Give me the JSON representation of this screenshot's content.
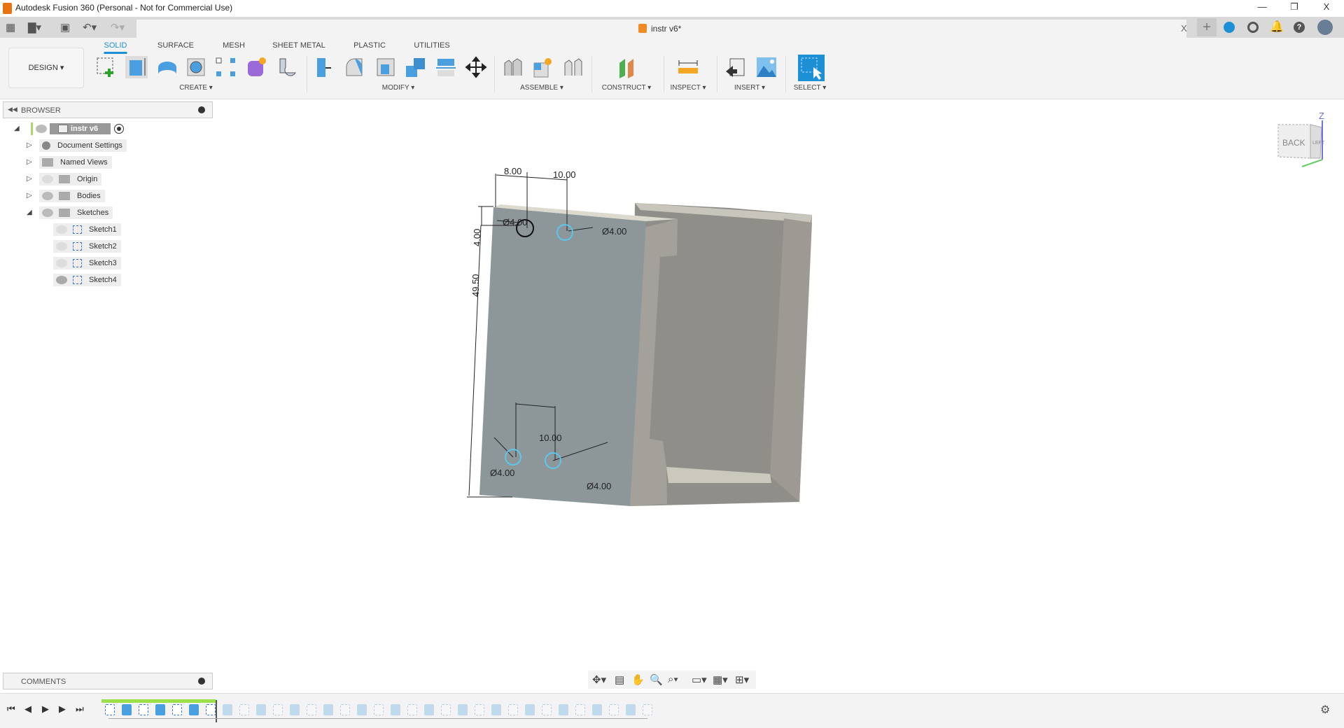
{
  "window": {
    "title": "Autodesk Fusion 360 (Personal - Not for Commercial Use)",
    "min": "—",
    "max": "❐",
    "close": "X"
  },
  "doc_tab": {
    "name": "instr v6*",
    "close": "X"
  },
  "ribbon": {
    "workspace": "DESIGN ▾",
    "tabs": [
      {
        "label": "SOLID",
        "active": true
      },
      {
        "label": "SURFACE"
      },
      {
        "label": "MESH"
      },
      {
        "label": "SHEET METAL"
      },
      {
        "label": "PLASTIC"
      },
      {
        "label": "UTILITIES"
      }
    ],
    "groups": [
      {
        "label": "CREATE ▾"
      },
      {
        "label": "MODIFY ▾"
      },
      {
        "label": "ASSEMBLE ▾"
      },
      {
        "label": "CONSTRUCT ▾"
      },
      {
        "label": "INSPECT ▾"
      },
      {
        "label": "INSERT ▾"
      },
      {
        "label": "SELECT ▾"
      }
    ]
  },
  "browser": {
    "title": "BROWSER",
    "root": "instr v6",
    "items": [
      {
        "label": "Document Settings"
      },
      {
        "label": "Named Views"
      },
      {
        "label": "Origin"
      },
      {
        "label": "Bodies"
      },
      {
        "label": "Sketches"
      }
    ],
    "sketches": [
      {
        "label": "Sketch1",
        "visible": false
      },
      {
        "label": "Sketch2",
        "visible": false
      },
      {
        "label": "Sketch3",
        "visible": false
      },
      {
        "label": "Sketch4",
        "visible": true
      }
    ]
  },
  "comments": {
    "title": "COMMENTS"
  },
  "viewcube": {
    "face": "BACK",
    "side": "LEFT",
    "axis": "Z"
  },
  "dimensions": {
    "d1": "8.00",
    "d2": "10.00",
    "d3": "4.00",
    "d4": "49.50",
    "d5": "10.00",
    "h1": "Ø4.00",
    "h2": "Ø4.00",
    "h3": "Ø4.00",
    "h4": "Ø4.00"
  },
  "colors": {
    "accent": "#1d8fd4",
    "timeline_active": "#9be04a"
  },
  "timeline": {
    "active_count": 7,
    "total_count": 33
  }
}
